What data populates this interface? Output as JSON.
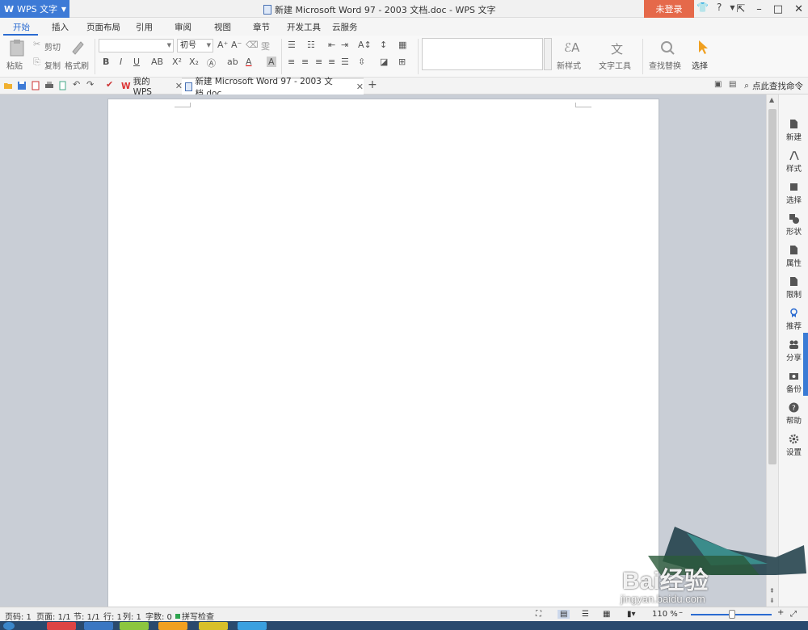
{
  "titlebar": {
    "app_name": "WPS 文字",
    "window_title": "新建 Microsoft Word 97 - 2003 文档.doc - WPS 文字",
    "login_label": "未登录"
  },
  "menu": {
    "tabs": [
      "开始",
      "插入",
      "页面布局",
      "引用",
      "审阅",
      "视图",
      "章节",
      "开发工具",
      "云服务"
    ]
  },
  "ribbon": {
    "paste": "粘贴",
    "cut": "剪切",
    "copy": "复制",
    "format_painter": "格式刷",
    "font_name": "",
    "font_size": "初号",
    "new_style": "新样式",
    "text_tools": "文字工具",
    "find_replace": "查找替换",
    "select": "选择"
  },
  "docbar": {
    "tab_mywps": "我的WPS",
    "tab_doc": "新建 Microsoft Word 97 - 2003 文档.doc",
    "find_command": "点此查找命令"
  },
  "right_panel": {
    "items": [
      "新建",
      "样式",
      "选择",
      "形状",
      "属性",
      "限制",
      "推荐",
      "分享",
      "备份",
      "帮助",
      "设置"
    ]
  },
  "statusbar": {
    "page_num": "页码: 1",
    "pages": "页面: 1/1",
    "section": "节: 1/1",
    "row": "行: 1",
    "col": "列: 1",
    "words": "字数: 0",
    "spell_check": "拼写检查",
    "zoom": "110 %"
  },
  "watermark": {
    "brand": "Bai经验",
    "url": "jingyan.baidu.com"
  },
  "colors": {
    "accent": "#2a6bd1",
    "app_button": "#3d7ad6",
    "login": "#e5694a"
  }
}
